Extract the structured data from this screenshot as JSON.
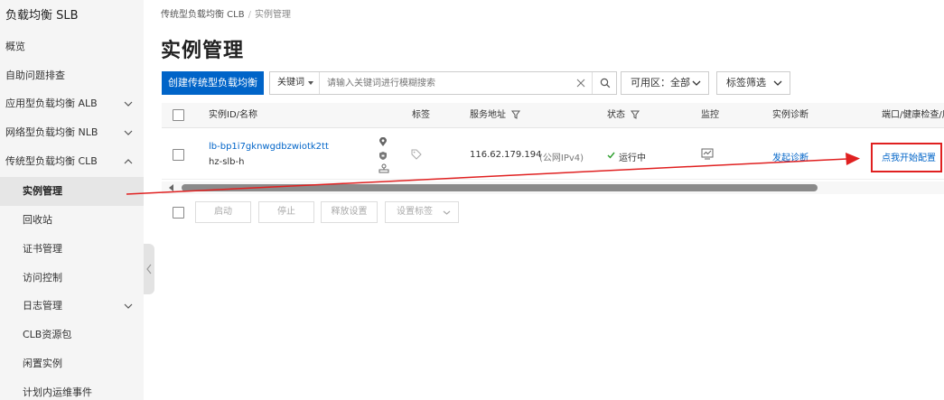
{
  "sidebar": {
    "title": "负载均衡 SLB",
    "items": [
      {
        "label": "概览"
      },
      {
        "label": "自助问题排查"
      },
      {
        "label": "应用型负载均衡 ALB"
      },
      {
        "label": "网络型负载均衡 NLB"
      },
      {
        "label": "传统型负载均衡 CLB"
      },
      {
        "label": "实例管理"
      },
      {
        "label": "回收站"
      },
      {
        "label": "证书管理"
      },
      {
        "label": "访问控制"
      },
      {
        "label": "日志管理"
      },
      {
        "label": "CLB资源包"
      },
      {
        "label": "闲置实例"
      },
      {
        "label": "计划内运维事件"
      }
    ]
  },
  "breadcrumb": {
    "parent": "传统型负载均衡 CLB",
    "separator": "/",
    "current": "实例管理"
  },
  "page_title": "实例管理",
  "toolbar": {
    "create_label": "创建传统型负载均衡",
    "search_key": "关键词",
    "search_placeholder": "请输入关键词进行模糊搜索",
    "zone_label": "可用区：",
    "zone_value": "全部",
    "tag_filter_label": "标签筛选"
  },
  "table": {
    "columns": {
      "id": "实例ID/名称",
      "tag": "标签",
      "address": "服务地址",
      "status": "状态",
      "monitor": "监控",
      "diagnose": "实例诊断",
      "port": "端口/健康检查/后"
    },
    "row": {
      "instance_id": "lb-bp1i7gknwgdbzwiotk2tt",
      "name": "hz-slb-h",
      "ip": "116.62.179.194",
      "network": "(公网IPv4)",
      "status": "运行中",
      "diagnose_action": "发起诊断",
      "config_action": "点我开始配置"
    }
  },
  "bulk_actions": {
    "start": "启动",
    "stop": "停止",
    "release": "释放设置",
    "set_tags": "设置标签"
  },
  "colors": {
    "primary": "#0064c8",
    "highlight": "#e02020",
    "status_ok": "#2a9d2a"
  }
}
